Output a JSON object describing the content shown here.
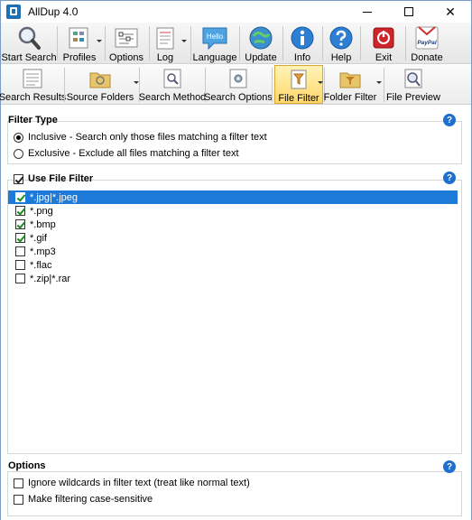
{
  "window": {
    "title": "AllDup 4.0"
  },
  "toolbar": {
    "buttons": [
      {
        "label": "Start Search",
        "icon": "magnifier-icon"
      },
      {
        "label": "Profiles",
        "icon": "profiles-icon"
      },
      {
        "label": "Options",
        "icon": "options-icon"
      },
      {
        "label": "Log",
        "icon": "log-icon"
      },
      {
        "label": "Language",
        "icon": "language-icon",
        "badge": "Hello"
      },
      {
        "label": "Update",
        "icon": "update-icon"
      },
      {
        "label": "Info",
        "icon": "info-icon"
      },
      {
        "label": "Help",
        "icon": "help-icon"
      },
      {
        "label": "Exit",
        "icon": "exit-icon"
      },
      {
        "label": "Donate",
        "icon": "donate-icon",
        "badge": "PayPal"
      }
    ]
  },
  "subtoolbar": {
    "buttons": [
      {
        "label": "Search Results",
        "icon": "search-results-icon"
      },
      {
        "label": "Source Folders",
        "icon": "source-folders-icon"
      },
      {
        "label": "Search Method",
        "icon": "search-method-icon"
      },
      {
        "label": "Search Options",
        "icon": "search-options-icon"
      },
      {
        "label": "File Filter",
        "icon": "file-filter-icon",
        "active": true
      },
      {
        "label": "Folder Filter",
        "icon": "folder-filter-icon"
      },
      {
        "label": "File Preview",
        "icon": "file-preview-icon"
      }
    ]
  },
  "filter_type": {
    "title": "Filter Type",
    "options": [
      {
        "label": "Inclusive - Search only those files matching a filter text",
        "selected": true
      },
      {
        "label": "Exclusive - Exclude all files matching a filter text",
        "selected": false
      }
    ]
  },
  "file_filter": {
    "title": "Use File Filter",
    "enabled": true,
    "items": [
      {
        "label": "*.jpg|*.jpeg",
        "checked": true,
        "selected": true
      },
      {
        "label": "*.png",
        "checked": true,
        "selected": false
      },
      {
        "label": "*.bmp",
        "checked": true,
        "selected": false
      },
      {
        "label": "*.gif",
        "checked": true,
        "selected": false
      },
      {
        "label": "*.mp3",
        "checked": false,
        "selected": false
      },
      {
        "label": "*.flac",
        "checked": false,
        "selected": false
      },
      {
        "label": "*.zip|*.rar",
        "checked": false,
        "selected": false
      }
    ]
  },
  "options": {
    "title": "Options",
    "items": [
      {
        "label": "Ignore wildcards in filter text (treat like normal text)",
        "checked": false
      },
      {
        "label": "Make filtering case-sensitive",
        "checked": false
      }
    ]
  },
  "help_glyph": "?",
  "colors": {
    "selection": "#1e7ad8",
    "help": "#1e6fd0",
    "active_tab": "#ffd86a"
  }
}
